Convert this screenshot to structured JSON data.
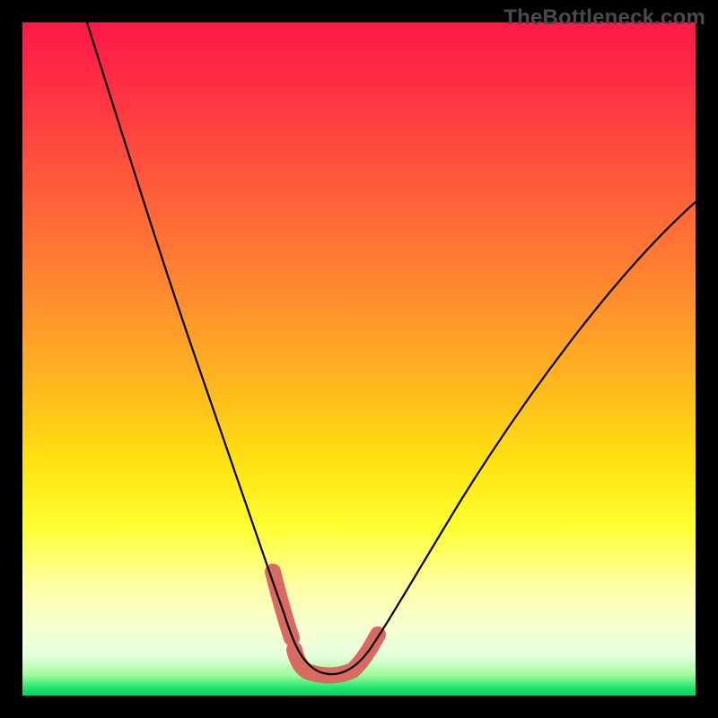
{
  "watermark": "TheBottleneck.com",
  "colors": {
    "accent_stroke": "#d96a62",
    "curve_stroke": "#000000",
    "gradient_top": "#ff1848",
    "gradient_bottom": "#00d45f",
    "frame": "#000000"
  },
  "chart_data": {
    "type": "line",
    "title": "",
    "xlabel": "",
    "ylabel": "",
    "xlim": [
      0,
      100
    ],
    "ylim": [
      0,
      100
    ],
    "grid": false,
    "note": "No axis ticks or numeric labels are rendered; values are estimated from pixel position with (0,0) at bottom-left.",
    "series": [
      {
        "name": "bottleneck-curve",
        "x": [
          10,
          14,
          18,
          22,
          26,
          30,
          34,
          38,
          40,
          42,
          44,
          46,
          48,
          50,
          54,
          60,
          66,
          72,
          80,
          90,
          100
        ],
        "y": [
          100,
          87,
          75,
          63,
          51,
          40,
          29,
          17,
          11,
          7,
          4,
          3,
          3,
          4,
          7,
          13,
          21,
          30,
          42,
          58,
          73
        ]
      }
    ],
    "annotations": [
      {
        "name": "valley-accent",
        "description": "Salmon-colored thick dashed segment highlighting the curve's minimum region",
        "x_range": [
          37,
          50
        ],
        "y_range": [
          3,
          17
        ]
      }
    ]
  }
}
